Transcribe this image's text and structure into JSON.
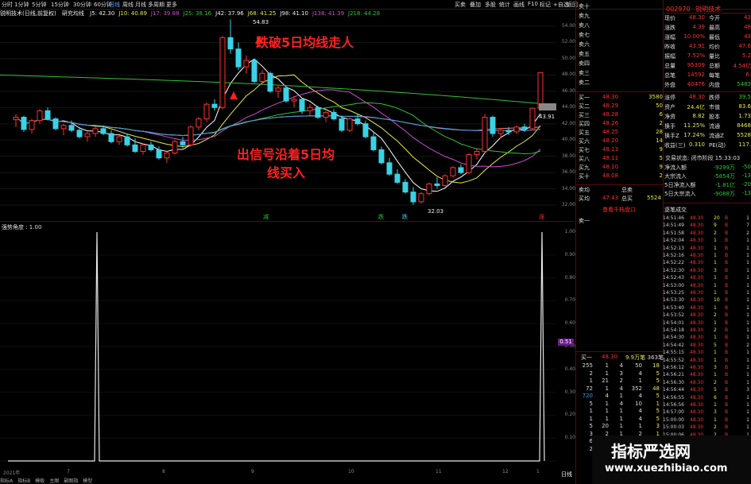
{
  "top_tabs": [
    "分时",
    "1分钟",
    "5分钟",
    "15分钟",
    "30分钟",
    "60分钟",
    "日线",
    "周线",
    "月线",
    "多周期",
    "更多"
  ],
  "active_tab": "日线",
  "right_tools": [
    "买卖",
    "叠加",
    "多股",
    "统计",
    "画线",
    "F10",
    "标记",
    "+自选",
    "返回"
  ],
  "indicator_line": {
    "name": "锐明技术(日线,前复权)",
    "study": "研究均线",
    "items": [
      {
        "t": "J5: 42.30",
        "c": "white"
      },
      {
        "t": "J10: 40.89",
        "c": "yellow"
      },
      {
        "t": "J17: 39.88",
        "c": "mag"
      },
      {
        "t": "J25: 38.16",
        "c": "green"
      },
      {
        "t": "J42: 37.96",
        "c": "white"
      },
      {
        "t": "J68: 41.25",
        "c": "yellow"
      },
      {
        "t": "J98: 41.10",
        "c": "white"
      },
      {
        "t": "J138: 41.39",
        "c": "mag"
      },
      {
        "t": "J218: 44.28",
        "c": "green"
      }
    ]
  },
  "price_axis": [
    "54.00",
    "52.00",
    "50.00",
    "48.00",
    "46.00",
    "44.00",
    "42.00",
    "40.00",
    "38.00",
    "36.00",
    "34.00",
    "32.00"
  ],
  "osc_axis": [
    "1.00",
    "0.90",
    "0.80",
    "0.70",
    "0.60",
    "0.50",
    "0.40",
    "0.30",
    "0.20",
    "0.10"
  ],
  "chart_marks": {
    "high": "54.83",
    "low": "32.03",
    "last": "43.91"
  },
  "current_level_tag": "0.51",
  "osc_title": "强势角度 : 1.00",
  "annotations": {
    "top": "跌破5日均线走人",
    "middle_line1": "出信号沿着5日均",
    "middle_line2": "线买入"
  },
  "bottom_markers": [
    "减",
    "跌",
    "跌",
    "涨"
  ],
  "x_axis": [
    "2021年",
    "7",
    "8",
    "9",
    "10",
    "11",
    "12",
    "1"
  ],
  "period_label": "日线",
  "stock": {
    "code": "002970",
    "name": "锐明技术"
  },
  "sell_levels": [
    "卖十",
    "卖九",
    "卖八",
    "卖七",
    "卖六",
    "卖五",
    "卖四",
    "卖三",
    "卖二",
    "卖一"
  ],
  "buy_book": [
    {
      "lbl": "买一",
      "px": "48.30",
      "qty": "3580"
    },
    {
      "lbl": "买二",
      "px": "48.29",
      "qty": "50"
    },
    {
      "lbl": "买三",
      "px": "48.28",
      "qty": "6"
    },
    {
      "lbl": "买四",
      "px": "48.26",
      "qty": "2"
    },
    {
      "lbl": "买五",
      "px": "48.25",
      "qty": "28"
    },
    {
      "lbl": "买六",
      "px": "48.20",
      "qty": "14"
    },
    {
      "lbl": "买七",
      "px": "48.13",
      "qty": "9"
    },
    {
      "lbl": "买八",
      "px": "48.11",
      "qty": "5"
    },
    {
      "lbl": "买九",
      "px": "48.10",
      "qty": "9"
    },
    {
      "lbl": "买十",
      "px": "48.08",
      "qty": "2"
    }
  ],
  "avg": {
    "lbl": "卖均",
    "lbl2": "买均",
    "px": "47.43",
    "t1": "总卖",
    "t2": "总买",
    "v2": "5524"
  },
  "view_book_btn": "查看千档盘口",
  "info": [
    {
      "a": "现价",
      "b": "48.30",
      "c": "今开",
      "d": "43"
    },
    {
      "a": "涨跌",
      "b": "4.39",
      "c": "最高",
      "d": "48"
    },
    {
      "a": "涨幅",
      "b": "10.00%",
      "c": "最低",
      "d": "43"
    },
    {
      "a": "昨收",
      "b": "43.91",
      "c": "均价",
      "d": "47.6"
    },
    {
      "a": "振幅",
      "b": "7.52%",
      "c": "量比",
      "d": "5.2"
    },
    {
      "a": "总量",
      "b": "95309",
      "c": "总额",
      "d": "4.54亿"
    },
    {
      "a": "总笔",
      "b": "14592",
      "c": "每笔",
      "d": "6."
    },
    {
      "a": "外盘",
      "b": "40476",
      "c": "内盘",
      "d": "5483"
    }
  ],
  "info2": [
    {
      "a": "涨停",
      "b": "48.30",
      "c": "跌停",
      "d": "39.5"
    },
    {
      "a": "资产",
      "b": "24.4亿",
      "c": "市值",
      "d": "83.6"
    },
    {
      "a": "净资",
      "b": "8.82",
      "c": "股本",
      "d": "1.73"
    },
    {
      "a": "换手",
      "b": "11.25%",
      "c": "流通",
      "d": "8468"
    },
    {
      "a": "换手Z",
      "b": "17.24%",
      "c": "流通Z",
      "d": "5528"
    },
    {
      "a": "收益(三)",
      "b": "0.310",
      "c": "PE(动)",
      "d": "117."
    }
  ],
  "trade_status": "交易状态: 闭市阶段 15:33:03",
  "flows": [
    {
      "a": "净流入额",
      "b": "-9299万",
      "c": "-50"
    },
    {
      "a": "大宗流入",
      "b": "-5854万",
      "c": "-13"
    },
    {
      "a": "5日净流入额",
      "b": "-1.81亿",
      "c": "-20"
    },
    {
      "a": "5日大宗流入",
      "b": "-9088万",
      "c": "-13"
    }
  ],
  "tape_title": "逐笔成交",
  "tape": [
    {
      "t": "14:51:46",
      "p": "48.30",
      "v": "20",
      "s": "B",
      "n": "1"
    },
    {
      "t": "14:51:49",
      "p": "48.30",
      "v": "9",
      "s": "B",
      "n": "7"
    },
    {
      "t": "14:51:58",
      "p": "48.30",
      "v": "2",
      "s": "B",
      "n": "2"
    },
    {
      "t": "14:52:04",
      "p": "48.30",
      "v": "1",
      "s": "B",
      "n": "1"
    },
    {
      "t": "14:52:13",
      "p": "48.30",
      "v": "1",
      "s": "B",
      "n": "1"
    },
    {
      "t": "14:52:16",
      "p": "48.30",
      "v": "1",
      "s": "B",
      "n": "1"
    },
    {
      "t": "14:52:22",
      "p": "48.30",
      "v": "1",
      "s": "B",
      "n": "1"
    },
    {
      "t": "14:52:30",
      "p": "48.30",
      "v": "3",
      "s": "B",
      "n": "1"
    },
    {
      "t": "14:52:43",
      "p": "48.30",
      "v": "1",
      "s": "B",
      "n": "1"
    },
    {
      "t": "14:53:00",
      "p": "48.30",
      "v": "1",
      "s": "B",
      "n": "1"
    },
    {
      "t": "14:53:25",
      "p": "48.30",
      "v": "1",
      "s": "B",
      "n": "1"
    },
    {
      "t": "14:53:30",
      "p": "48.30",
      "v": "10",
      "s": "B",
      "n": "1"
    },
    {
      "t": "14:53:40",
      "p": "48.30",
      "v": "1",
      "s": "B",
      "n": "1"
    },
    {
      "t": "14:53:52",
      "p": "48.30",
      "v": "2",
      "s": "B",
      "n": "1"
    },
    {
      "t": "14:54:01",
      "p": "48.30",
      "v": "1",
      "s": "B",
      "n": "1"
    },
    {
      "t": "14:54:18",
      "p": "48.30",
      "v": "2",
      "s": "B",
      "n": "1"
    },
    {
      "t": "14:54:30",
      "p": "48.30",
      "v": "1",
      "s": "B",
      "n": "1"
    },
    {
      "t": "14:54:42",
      "p": "48.30",
      "v": "5",
      "s": "B",
      "n": "2"
    },
    {
      "t": "14:55:15",
      "p": "48.30",
      "v": "1",
      "s": "B",
      "n": "1"
    },
    {
      "t": "14:55:52",
      "p": "48.30",
      "v": "1",
      "s": "B",
      "n": "1"
    },
    {
      "t": "14:56:12",
      "p": "48.30",
      "v": "3",
      "s": "B",
      "n": "1"
    },
    {
      "t": "14:56:21",
      "p": "48.30",
      "v": "1",
      "s": "B",
      "n": "1"
    },
    {
      "t": "14:56:30",
      "p": "48.30",
      "v": "2",
      "s": "B",
      "n": "1"
    },
    {
      "t": "14:56:44",
      "p": "48.30",
      "v": "5",
      "s": "B",
      "n": "3"
    },
    {
      "t": "14:56:55",
      "p": "48.30",
      "v": "6",
      "s": "B",
      "n": "1"
    },
    {
      "t": "14:56:56",
      "p": "48.30",
      "v": "1",
      "s": "B",
      "n": "1"
    },
    {
      "t": "14:57:00",
      "p": "48.30",
      "v": "3",
      "s": "B",
      "n": "1"
    },
    {
      "t": "15:00:00",
      "p": "48.30",
      "v": "1",
      "s": "B",
      "n": "1"
    },
    {
      "t": "15:00:03",
      "p": "48.30",
      "v": "2",
      "s": "B",
      "n": "1"
    },
    {
      "t": "15:00:06",
      "p": "48.30",
      "v": "2",
      "s": "B",
      "n": "1"
    }
  ],
  "bq_header": {
    "a": "买一",
    "b": "48.30",
    "c": "9.9万笔",
    "d": "363笔"
  },
  "bq_rows": [
    [
      "255",
      "1",
      "4",
      "50",
      "18"
    ],
    [
      "2",
      "1",
      "3",
      "4",
      "5"
    ],
    [
      "1",
      "21",
      "2",
      "1",
      "5"
    ],
    [
      "72",
      "1",
      "4",
      "352",
      "48"
    ],
    [
      "720",
      "4",
      "1",
      "4",
      "5"
    ],
    [
      "5",
      "1",
      "4",
      "10",
      "1"
    ],
    [
      "1",
      "1",
      "1",
      "4",
      "5"
    ],
    [
      "1",
      "1",
      "1",
      "4",
      "5"
    ],
    [
      "5",
      "20",
      "1",
      "1",
      "3"
    ],
    [
      "3",
      "2",
      "1",
      "2",
      "1"
    ],
    [
      "6",
      "",
      "",
      "",
      ""
    ],
    [
      "2",
      "",
      "",
      "",
      ""
    ]
  ],
  "watermark": {
    "cn": "指标严选网",
    "url": "www.xuezhibiao.com"
  },
  "status_bar": [
    "指标A",
    "指标B",
    "模板",
    "主图",
    "副图指",
    "模型"
  ],
  "colors": {
    "up": "#ff3030",
    "down": "#2ec52e",
    "flat_candle": "#39d2e6",
    "bg": "#000000"
  },
  "chart_data": {
    "type": "line",
    "title": "",
    "ylim": [
      0,
      1
    ],
    "x": [
      "7",
      "8",
      "9",
      "10",
      "11",
      "12",
      "1"
    ],
    "series": [
      {
        "name": "强势角度",
        "values": [
          0,
          0,
          1,
          0,
          0,
          0,
          0,
          0,
          0,
          0,
          0,
          0,
          1
        ]
      }
    ],
    "candles": [
      [
        42.5,
        43.2,
        41.6,
        42.8
      ],
      [
        42.8,
        43.0,
        41.0,
        41.3
      ],
      [
        41.3,
        42.6,
        40.8,
        42.4
      ],
      [
        42.4,
        43.8,
        42.0,
        43.6
      ],
      [
        43.6,
        44.0,
        42.4,
        42.6
      ],
      [
        42.6,
        42.8,
        41.2,
        41.4
      ],
      [
        41.4,
        42.0,
        40.6,
        41.8
      ],
      [
        41.8,
        42.4,
        41.0,
        41.2
      ],
      [
        41.2,
        41.6,
        40.2,
        40.4
      ],
      [
        40.4,
        41.0,
        39.8,
        40.8
      ],
      [
        40.8,
        41.6,
        40.4,
        41.4
      ],
      [
        41.4,
        41.8,
        40.6,
        40.8
      ],
      [
        40.8,
        41.2,
        39.6,
        39.8
      ],
      [
        39.8,
        40.6,
        39.4,
        40.4
      ],
      [
        40.4,
        40.8,
        39.2,
        39.4
      ],
      [
        39.4,
        40.2,
        38.4,
        38.6
      ],
      [
        38.6,
        39.6,
        38.2,
        39.4
      ],
      [
        39.4,
        39.8,
        38.6,
        38.8
      ],
      [
        38.8,
        39.2,
        37.6,
        37.8
      ],
      [
        37.8,
        38.6,
        37.2,
        38.4
      ],
      [
        38.4,
        40.0,
        38.2,
        39.8
      ],
      [
        39.8,
        40.4,
        39.0,
        39.4
      ],
      [
        39.4,
        41.8,
        39.2,
        41.6
      ],
      [
        41.6,
        42.8,
        41.2,
        42.6
      ],
      [
        42.6,
        44.6,
        42.2,
        44.4
      ],
      [
        44.4,
        45.0,
        43.6,
        44.0
      ],
      [
        44.0,
        52.8,
        43.8,
        52.6
      ],
      [
        52.6,
        54.83,
        50.6,
        51.2
      ],
      [
        51.2,
        52.0,
        48.6,
        49.0
      ],
      [
        49.0,
        50.4,
        48.2,
        49.8
      ],
      [
        49.8,
        50.0,
        47.0,
        47.2
      ],
      [
        47.2,
        48.6,
        46.8,
        48.2
      ],
      [
        48.2,
        48.4,
        45.8,
        46.0
      ],
      [
        46.0,
        46.8,
        45.2,
        46.4
      ],
      [
        46.4,
        46.6,
        44.6,
        44.8
      ],
      [
        44.8,
        45.4,
        44.0,
        45.0
      ],
      [
        45.0,
        45.2,
        43.2,
        43.6
      ],
      [
        43.6,
        44.4,
        43.0,
        44.0
      ],
      [
        44.0,
        44.2,
        42.6,
        42.8
      ],
      [
        42.8,
        43.6,
        42.2,
        43.4
      ],
      [
        43.4,
        43.8,
        42.4,
        42.6
      ],
      [
        42.6,
        43.0,
        41.0,
        41.2
      ],
      [
        41.2,
        42.8,
        41.0,
        42.6
      ],
      [
        42.6,
        43.2,
        41.8,
        42.0
      ],
      [
        42.0,
        42.4,
        40.2,
        40.4
      ],
      [
        40.4,
        41.0,
        38.6,
        38.8
      ],
      [
        38.8,
        39.2,
        37.0,
        37.2
      ],
      [
        37.2,
        37.8,
        35.6,
        35.8
      ],
      [
        35.8,
        36.4,
        34.6,
        34.8
      ],
      [
        34.8,
        35.2,
        33.4,
        33.6
      ],
      [
        33.6,
        34.2,
        32.03,
        32.4
      ],
      [
        32.4,
        33.6,
        32.2,
        33.4
      ],
      [
        33.4,
        34.8,
        33.2,
        34.6
      ],
      [
        34.6,
        35.4,
        34.0,
        34.4
      ],
      [
        34.4,
        35.8,
        34.2,
        35.6
      ],
      [
        35.6,
        36.8,
        35.4,
        36.6
      ],
      [
        36.6,
        37.0,
        35.8,
        36.0
      ],
      [
        36.0,
        38.4,
        35.8,
        38.2
      ],
      [
        38.2,
        39.0,
        37.6,
        38.6
      ],
      [
        38.6,
        43.2,
        38.4,
        42.8
      ],
      [
        42.8,
        43.0,
        40.4,
        40.8
      ],
      [
        40.8,
        41.4,
        40.2,
        41.2
      ],
      [
        41.2,
        41.6,
        40.6,
        41.0
      ],
      [
        41.0,
        41.8,
        40.8,
        41.6
      ],
      [
        41.6,
        42.0,
        41.0,
        41.4
      ],
      [
        41.4,
        43.91,
        41.2,
        43.91
      ],
      [
        43.91,
        48.3,
        43.6,
        48.3
      ]
    ]
  }
}
